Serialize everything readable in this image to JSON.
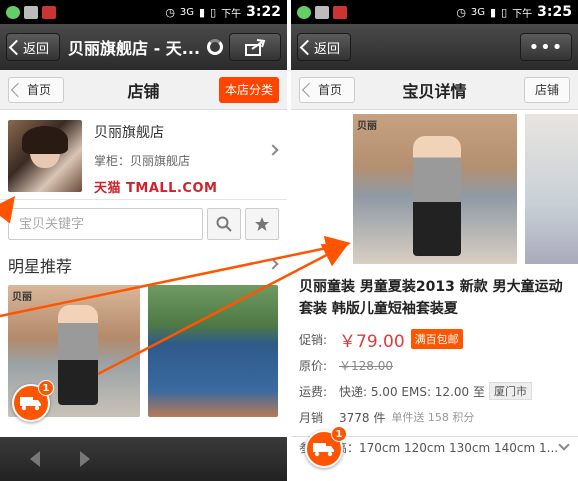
{
  "status_bar_left": {
    "carrier_icon": "3G",
    "battery": "",
    "time_prefix": "下午",
    "time": "3:22"
  },
  "status_bar_right": {
    "carrier_icon": "3G",
    "time_prefix": "下午",
    "time": "3:25"
  },
  "left": {
    "back_label": "返回",
    "title": "贝丽旗舰店 - 天...",
    "home_label": "首页",
    "page_title": "店铺",
    "category_btn": "本店分类",
    "shop_name": "贝丽旗舰店",
    "shop_keeper": "掌柜：贝丽旗舰店",
    "tmall_label": "天猫 TMALL.COM",
    "search_placeholder": "宝贝关键字",
    "section_title": "明星推荐",
    "brand_tag": "贝丽",
    "cart_count": "1"
  },
  "right": {
    "back_label": "返回",
    "more_label": "•••",
    "home_label": "首页",
    "page_title": "宝贝详情",
    "shop_btn": "店铺",
    "brand_tag": "贝丽",
    "product_title": "贝丽童装 男童夏装2013 新款 男大童运动套装 韩版儿童短袖套装夏",
    "promo_label": "促销:",
    "promo_price": "￥79.00",
    "free_shipping": "满百包邮",
    "orig_label": "原价:",
    "orig_price": "￥128.00",
    "shipping_label": "运费:",
    "shipping_value": "快递: 5.00 EMS: 12.00 至",
    "shipping_city": "厦门市",
    "sales_label": "月销",
    "sales_value": "3778 件",
    "sales_sub": "单件送 158 积分",
    "height_label": "参考身高：170cm 120cm 130cm 140cm 1...",
    "cart_count": "1"
  },
  "colors": {
    "accent": "#ff4400",
    "arrow": "#ff5500",
    "price": "#e4393c",
    "tmall": "#d3202a"
  },
  "icons": [
    "back-chevron-icon",
    "share-icon",
    "more-icon",
    "search-icon",
    "star-icon",
    "cart-truck-icon",
    "chevron-right-icon",
    "chevron-down-icon",
    "nav-prev-icon",
    "nav-next-icon"
  ]
}
